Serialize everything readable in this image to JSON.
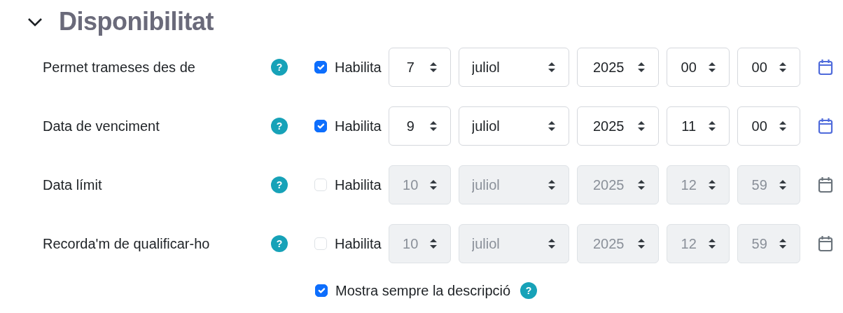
{
  "section": {
    "title": "Disponibilitat",
    "expanded": true
  },
  "date_rows": [
    {
      "label": "Permet trameses des de",
      "help": "?",
      "enable_label": "Habilita",
      "enabled": true,
      "day": "7",
      "month": "juliol",
      "year": "2025",
      "hour": "00",
      "minute": "00"
    },
    {
      "label": "Data de venciment",
      "help": "?",
      "enable_label": "Habilita",
      "enabled": true,
      "day": "9",
      "month": "juliol",
      "year": "2025",
      "hour": "11",
      "minute": "00"
    },
    {
      "label": "Data límit",
      "help": "?",
      "enable_label": "Habilita",
      "enabled": false,
      "day": "10",
      "month": "juliol",
      "year": "2025",
      "hour": "12",
      "minute": "59"
    },
    {
      "label": "Recorda'm de qualificar-ho",
      "help": "?",
      "enable_label": "Habilita",
      "enabled": false,
      "day": "10",
      "month": "juliol",
      "year": "2025",
      "hour": "12",
      "minute": "59"
    }
  ],
  "always_show_description": {
    "label": "Mostra sempre la descripció",
    "help": "?",
    "checked": true
  }
}
